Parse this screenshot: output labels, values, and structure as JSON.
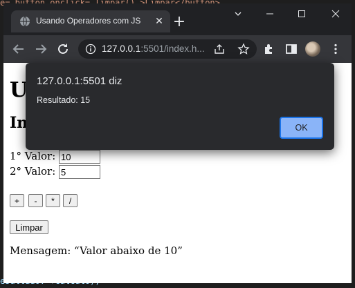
{
  "editor_background": {
    "top_code": "e= button  onclick= limpar() >Limpar</button>",
    "bottom_code": "esultado:  +calculo);"
  },
  "browser": {
    "tab_title": "Usando Operadores com JS",
    "url_host": "127.0.0.1",
    "url_rest": ":5501/index.h...",
    "icons": [
      "globe-icon",
      "close-icon",
      "plus-icon",
      "back-arrow-icon",
      "forward-arrow-icon",
      "reload-icon",
      "info-icon",
      "share-icon",
      "star-icon",
      "puzzle-icon",
      "side-panel-icon",
      "avatar",
      "kebab-menu-icon",
      "chevron-down-icon",
      "minimize-icon",
      "maximize-icon",
      "close-window-icon"
    ]
  },
  "page": {
    "heading1": "U",
    "heading2": "In",
    "field1_label": "1° Valor:",
    "field1_value": "10",
    "field2_label": "2° Valor:",
    "field2_value": "5",
    "operators": [
      "+",
      "-",
      "*",
      "/"
    ],
    "clear_label": "Limpar",
    "message": "Mensagem: “Valor abaixo de 10”"
  },
  "dialog": {
    "title": "127.0.0.1:5501 diz",
    "message": "Resultado: 15",
    "ok_label": "OK"
  },
  "colors": {
    "chrome_dark": "#202124",
    "toolbar": "#35363a",
    "dialog_bg": "#292a2d",
    "ok_button": "#8ab4f8"
  }
}
